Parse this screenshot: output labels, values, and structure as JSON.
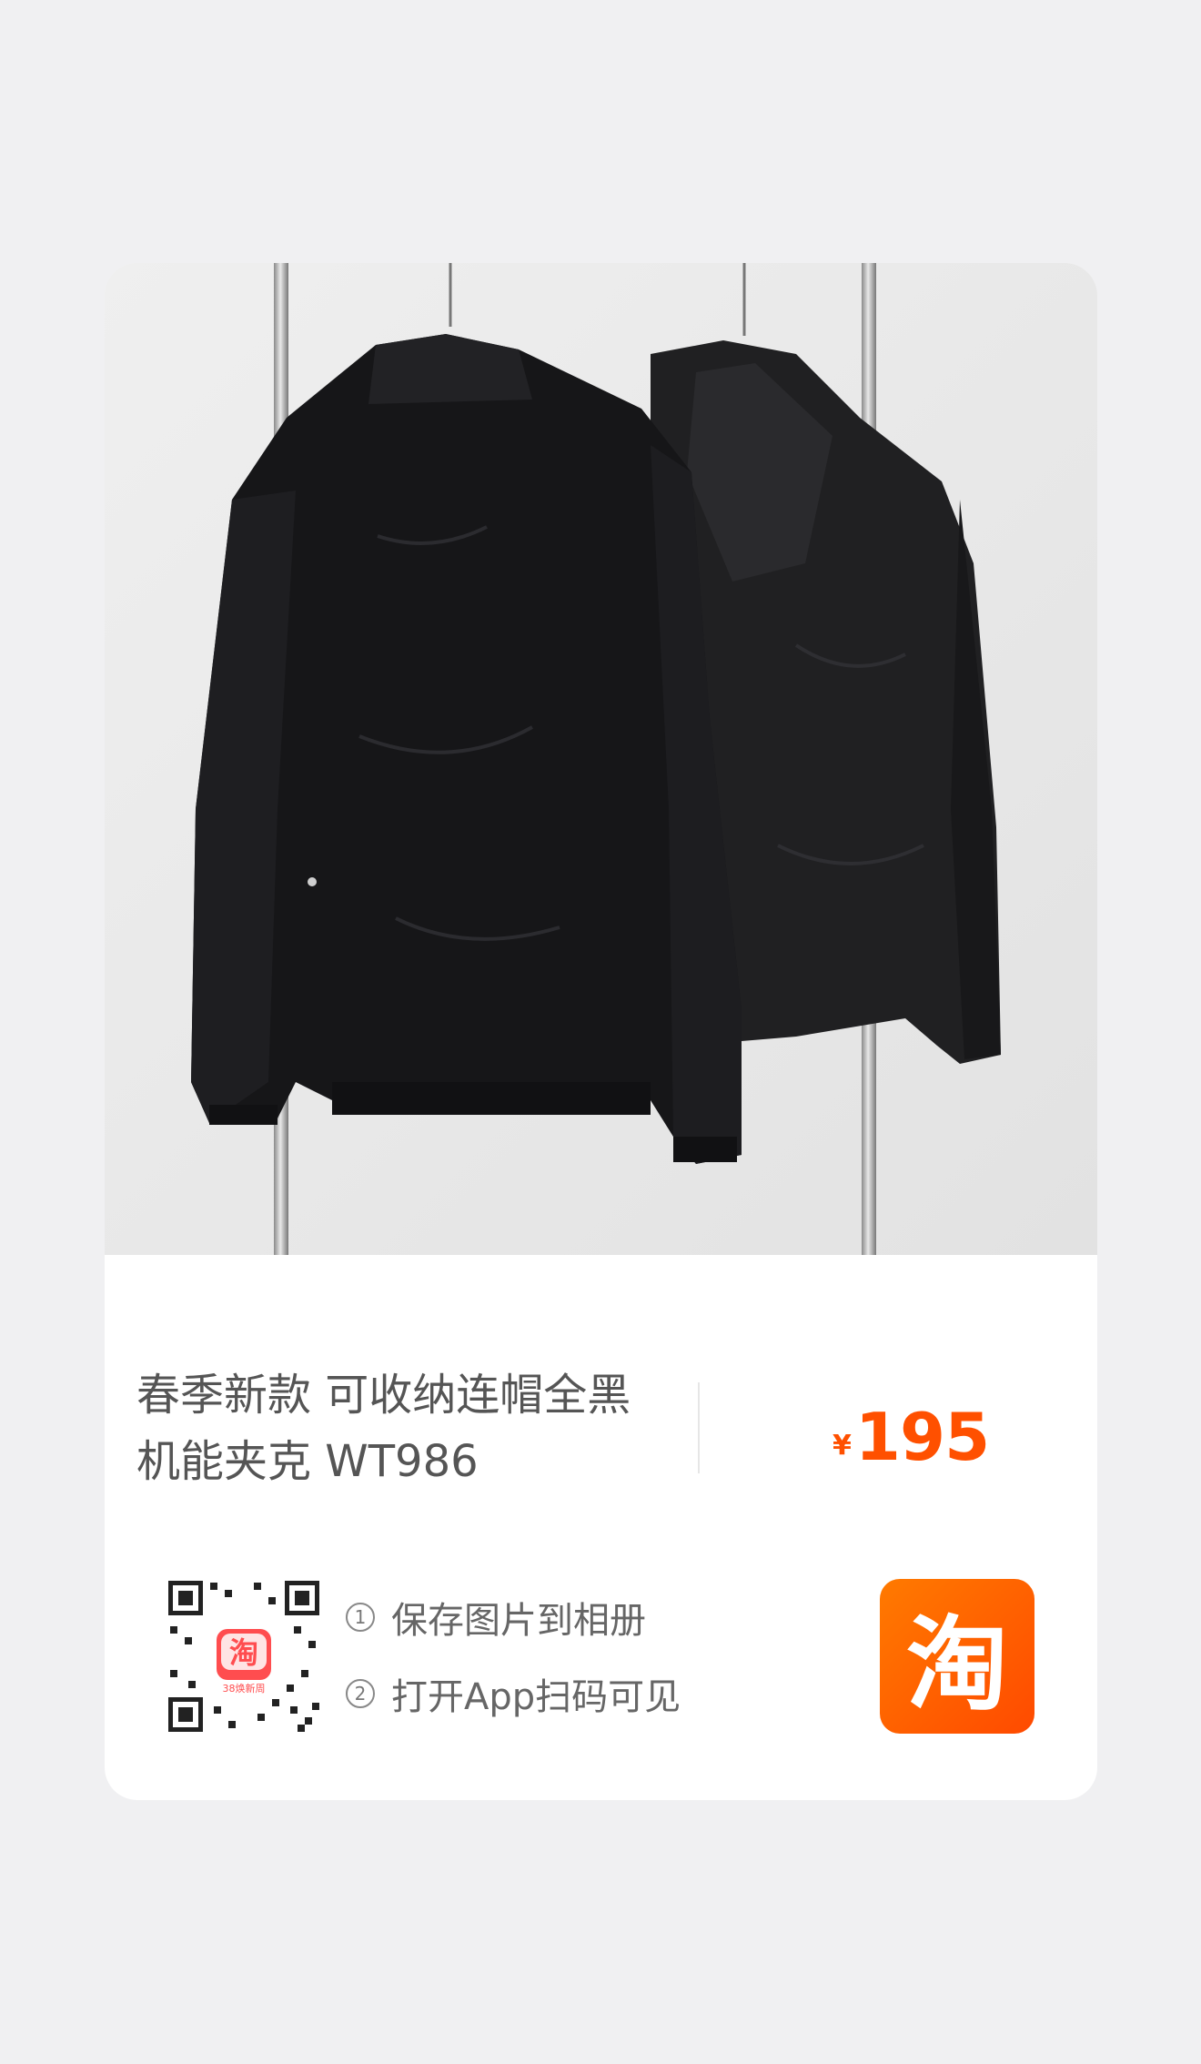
{
  "product": {
    "title_line1": "春季新款 可收纳连帽全黑",
    "title_line2": "机能夹克 WT986",
    "currency": "¥",
    "price": "195"
  },
  "qr": {
    "badge_text": "淘",
    "badge_caption": "38焕新周"
  },
  "instructions": {
    "step1_num": "1",
    "step1": "保存图片到相册",
    "step2_num": "2",
    "step2": "打开App扫码可见"
  },
  "app_logo": {
    "text": "淘"
  },
  "colors": {
    "price": "#ff5000",
    "logo": "#ff5a00",
    "page_bg": "#f0f0f2",
    "card_bg": "#ffffff"
  }
}
